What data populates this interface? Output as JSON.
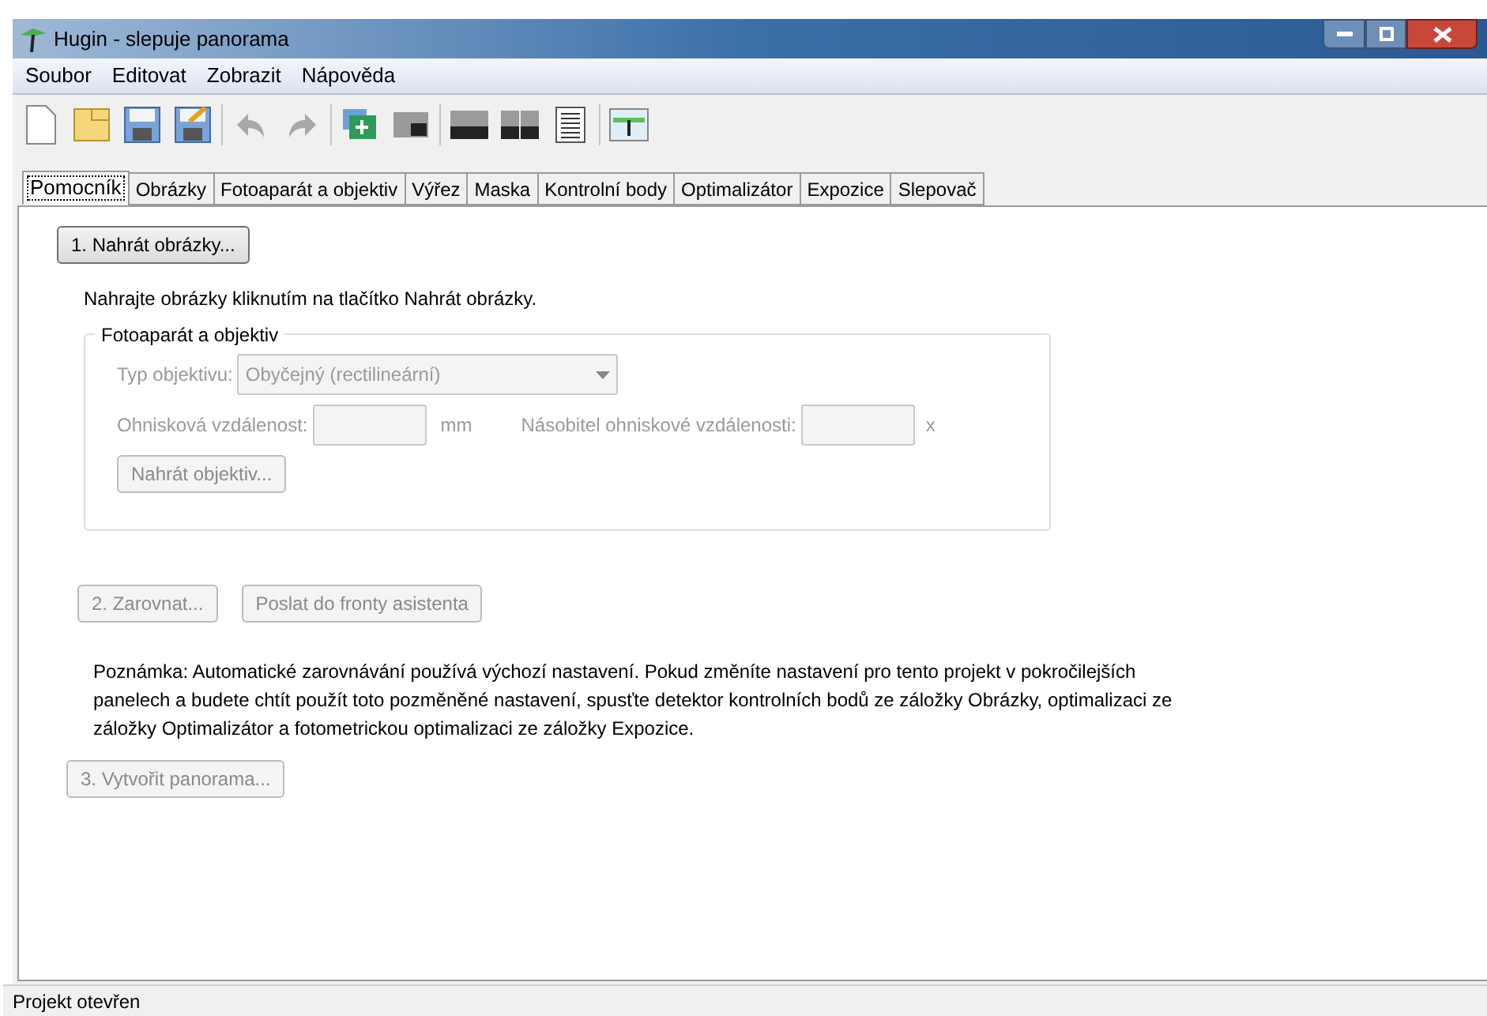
{
  "window": {
    "title": "Hugin - slepuje panorama"
  },
  "menu": [
    "Soubor",
    "Editovat",
    "Zobrazit",
    "Nápověda"
  ],
  "tabs": [
    {
      "label": "Pomocník",
      "selected": true
    },
    {
      "label": "Obrázky",
      "selected": false
    },
    {
      "label": "Fotoaparát a objektiv",
      "selected": false
    },
    {
      "label": "Výřez",
      "selected": false
    },
    {
      "label": "Maska",
      "selected": false
    },
    {
      "label": "Kontrolní body",
      "selected": false
    },
    {
      "label": "Optimalizátor",
      "selected": false
    },
    {
      "label": "Expozice",
      "selected": false
    },
    {
      "label": "Slepovač",
      "selected": false
    }
  ],
  "load_images_button": {
    "label": "1. Nahrát obrázky...",
    "disabled": false
  },
  "instruction": "Nahrajte obrázky kliknutím na tlačítko Nahrát obrázky.",
  "lens_group": {
    "title": "Fotoaparát a objektiv",
    "disabled": true,
    "lens_type_label": "Typ objektivu:",
    "lens_type_value": "Obyčejný (rectilineární)",
    "focal_length_label": "Ohnisková vzdálenost:",
    "focal_length_unit": "mm",
    "crop_factor_label": "Násobitel ohniskové vzdálenosti:",
    "crop_factor_unit": "x",
    "load_lens_button": "Nahrát objektiv..."
  },
  "align_button": {
    "label": "2. Zarovnat...",
    "disabled": true
  },
  "queue_button": {
    "label": "Poslat do fronty asistenta",
    "disabled": true
  },
  "note": "Poznámka: Automatické zarovnávání používá výchozí nastavení.  Pokud změníte nastavení pro tento projekt v pokročilejších panelech a budete chtít použít toto pozměněné nastavení, spusťte detektor kontrolních bodů ze záložky Obrázky, optimalizaci ze záložky Optimalizátor a fotometrickou optimalizaci ze záložky Expozice.",
  "create_button": {
    "label": "3. Vytvořit panorama...",
    "disabled": true
  },
  "status_bar": "Projekt otevřen"
}
